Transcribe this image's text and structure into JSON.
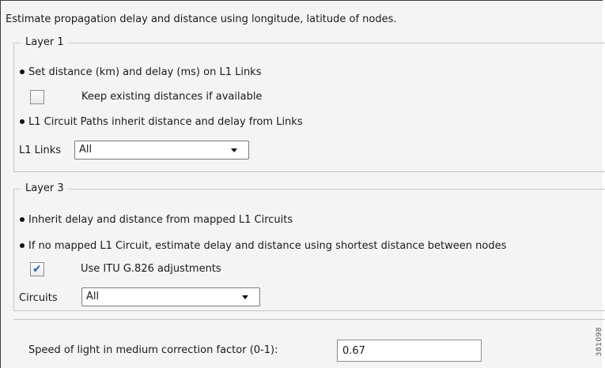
{
  "description": "Estimate propagation delay and distance using longitude, latitude of nodes.",
  "layer1": {
    "title": "Layer 1",
    "bullet_set_distance": "Set distance (km) and delay (ms) on L1 Links",
    "keep_existing_label": "Keep existing distances if available",
    "keep_existing_checked": false,
    "bullet_circuit_paths": "L1 Circuit Paths inherit distance and delay from Links",
    "links_label": "L1 Links",
    "links_value": "All"
  },
  "layer3": {
    "title": "Layer 3",
    "bullet_inherit": "Inherit delay and distance from mapped L1 Circuits",
    "bullet_no_mapped": "If no mapped L1 Circuit, estimate delay and distance using shortest distance between nodes",
    "itu_label": "Use ITU G.826 adjustments",
    "itu_checked": true,
    "circuits_label": "Circuits",
    "circuits_value": "All"
  },
  "speed": {
    "label": "Speed of light in medium correction factor (0-1):",
    "value": "0.67"
  },
  "figure_id": "381098",
  "colors": {
    "checkmark": "#2a62b5",
    "panel_bg": "#f4f4f4",
    "group_border": "#c6c6c6"
  }
}
